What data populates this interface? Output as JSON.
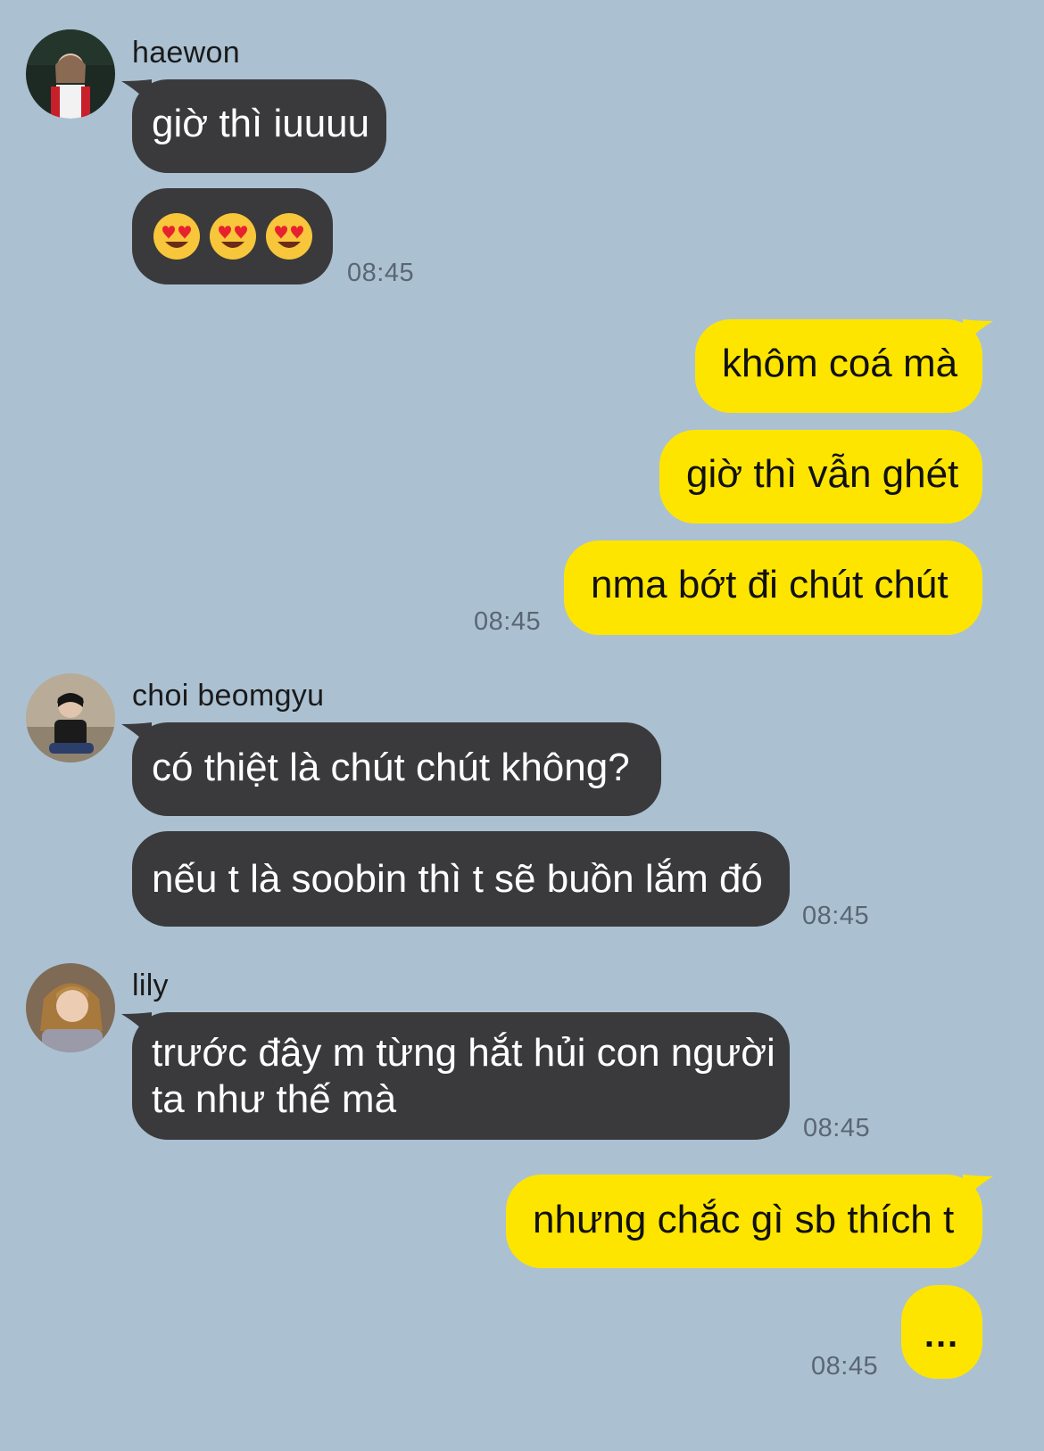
{
  "conversation": {
    "groups": [
      {
        "sender": "haewon",
        "messages": [
          "giờ thì iuuuu",
          "😍😍😍"
        ],
        "time": "08:45"
      },
      {
        "sender": "me",
        "messages": [
          "khôm coá mà",
          "giờ thì vẫn ghét",
          "nma bớt đi chút chút"
        ],
        "time": "08:45"
      },
      {
        "sender": "choi beomgyu",
        "messages": [
          "có thiệt là chút chút không?",
          "nếu t là soobin thì t sẽ buồn lắm đó"
        ],
        "time": "08:45"
      },
      {
        "sender": "lily",
        "messages": [
          "trước đây m từng hắt hủi con người",
          "ta như thế mà"
        ],
        "time": "08:45"
      },
      {
        "sender": "me",
        "messages": [
          "nhưng chắc gì sb thích t",
          "..."
        ],
        "time": "08:45"
      }
    ]
  },
  "colors": {
    "background": "#abc1d2",
    "incoming_bubble": "#3a3a3c",
    "outgoing_bubble": "#fee500"
  },
  "icons": {
    "emoji": "smiling-face-with-heart-eyes"
  }
}
